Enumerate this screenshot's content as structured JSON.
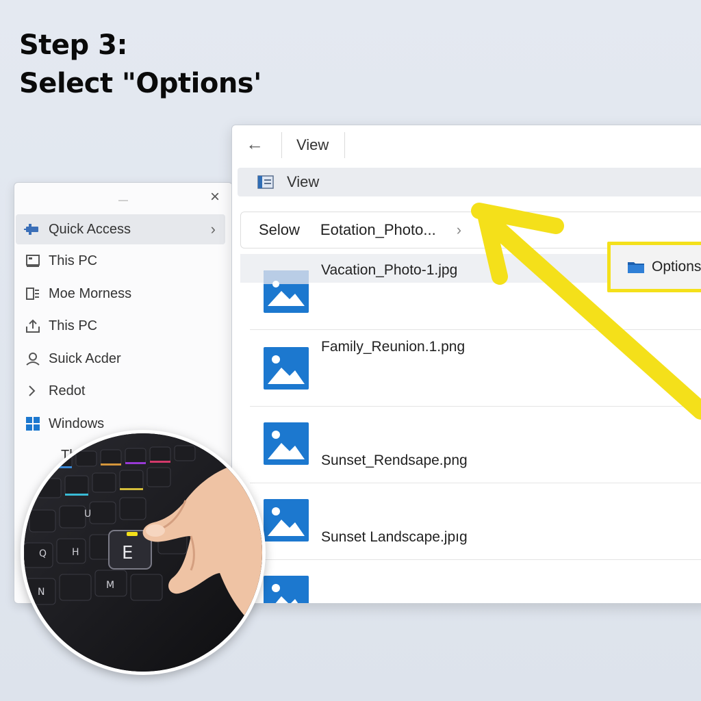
{
  "step": {
    "line1": "Step 3:",
    "line2": "Select \"Options'"
  },
  "nav_window": {
    "close_glyph": "×",
    "items": [
      {
        "label": "Quick Access",
        "icon": "pin-icon",
        "selected": true,
        "chevron": "›"
      },
      {
        "label": "This PC",
        "icon": "pc-icon"
      },
      {
        "label": "Moe Morness",
        "icon": "list-icon"
      },
      {
        "label": "This PC",
        "icon": "upload-icon"
      },
      {
        "label": "Suick Acder",
        "icon": "user-icon"
      },
      {
        "label": "Redot",
        "icon": "chevron-right-icon"
      },
      {
        "label": "Windows",
        "icon": "windows-logo-icon"
      },
      {
        "label": "Th",
        "icon": ""
      }
    ]
  },
  "explorer": {
    "back_glyph": "←",
    "tab_label": "View",
    "view_bar_label": "View",
    "address": {
      "crumb1": "Selow",
      "crumb2": "Eotation_Photo...",
      "chevron": "›"
    },
    "files": [
      {
        "name": "Vacation_Photo-1.jpg",
        "icon": "image-file-icon"
      },
      {
        "name": "Family_Reunion.1.png",
        "icon": "image-file-icon"
      },
      {
        "name": "Sunset_Rendsape.png",
        "icon": "image-file-icon"
      },
      {
        "name": "Sunset Landscape.jpıg",
        "icon": "image-file-icon"
      },
      {
        "name": "",
        "icon": "image-file-icon"
      }
    ],
    "options_label": "Options"
  },
  "keyboard_photo": {
    "key_label": "E",
    "letters": [
      "Q",
      "U",
      "H",
      "N",
      "M"
    ]
  },
  "colors": {
    "highlight": "#f4e01a",
    "accent": "#1c78cf",
    "background": "#e1e6ee"
  }
}
